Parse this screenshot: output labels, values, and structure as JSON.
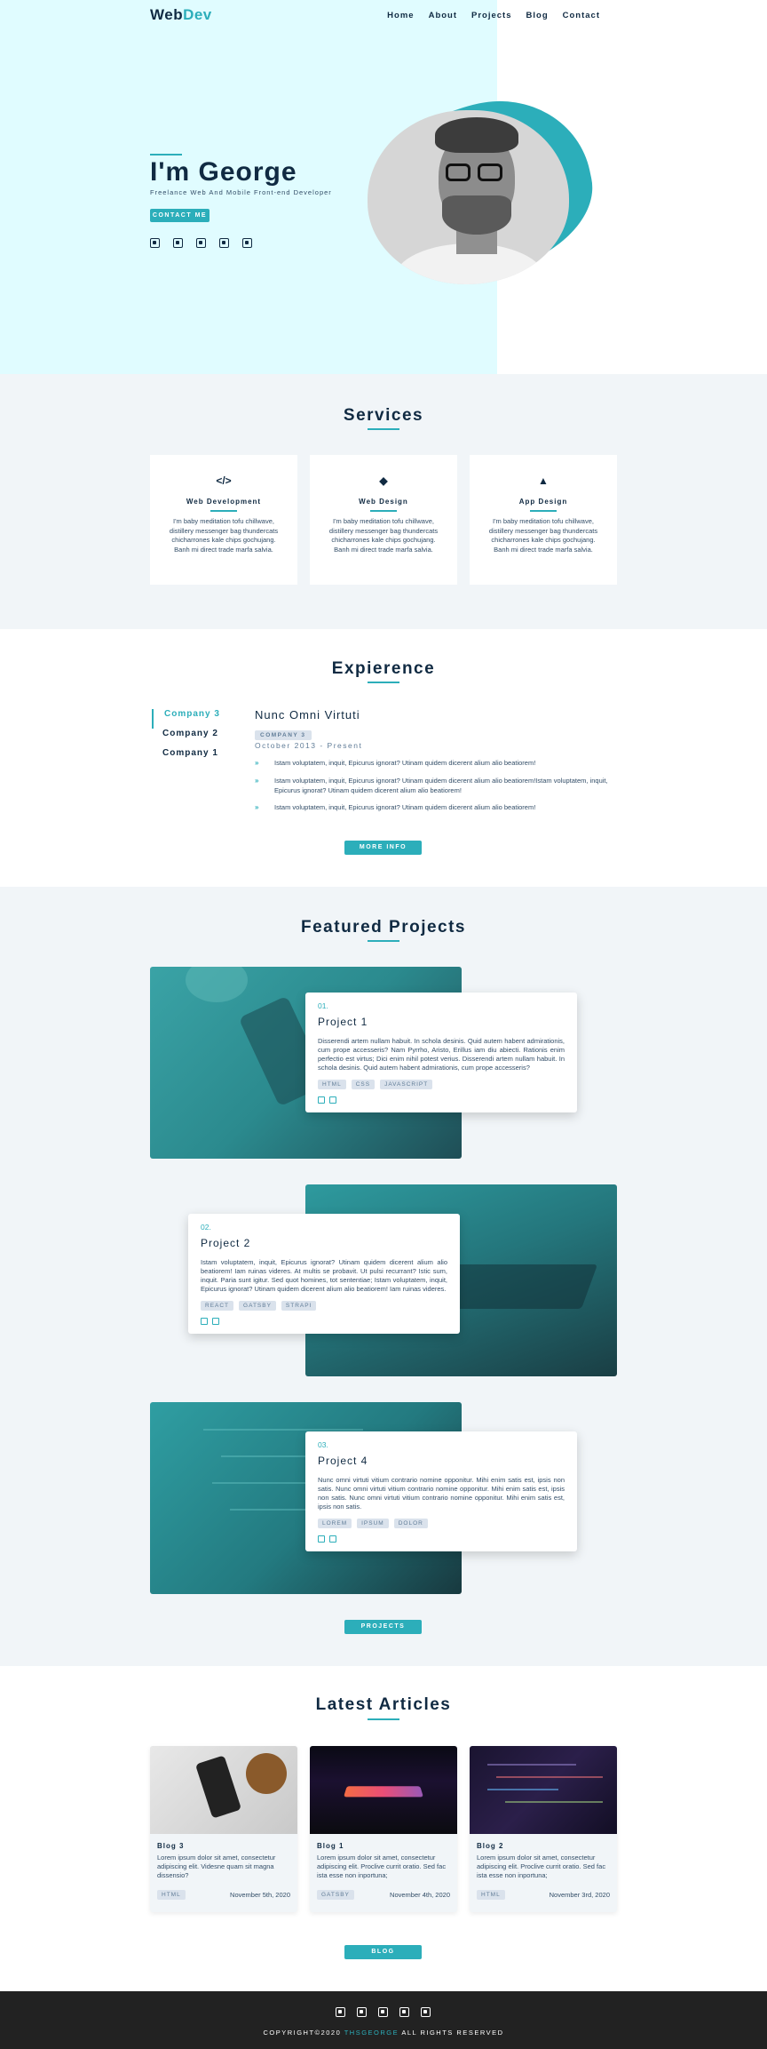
{
  "nav": {
    "logo_a": "Web",
    "logo_b": "Dev",
    "links": [
      "Home",
      "About",
      "Projects",
      "Blog",
      "Contact"
    ]
  },
  "hero": {
    "title": "I'm George",
    "subtitle": "Freelance Web And Mobile Front-end Developer",
    "cta": "CONTACT ME",
    "social": [
      "facebook-icon",
      "linkedin-icon",
      "squarespace-icon",
      "sourcetree-icon",
      "twitter-icon"
    ]
  },
  "services": {
    "title": "Services",
    "items": [
      {
        "icon": "</>",
        "title": "Web Development",
        "text": "I'm baby meditation tofu chillwave, distillery messenger bag thundercats chicharrones kale chips gochujang. Banh mi direct trade marfa salvia."
      },
      {
        "icon": "◆",
        "title": "Web Design",
        "text": "I'm baby meditation tofu chillwave, distillery messenger bag thundercats chicharrones kale chips gochujang. Banh mi direct trade marfa salvia."
      },
      {
        "icon": "▲",
        "title": "App Design",
        "text": "I'm baby meditation tofu chillwave, distillery messenger bag thundercats chicharrones kale chips gochujang. Banh mi direct trade marfa salvia."
      }
    ]
  },
  "experience": {
    "title": "Expierence",
    "tabs": [
      "Company 3",
      "Company 2",
      "Company 1"
    ],
    "job_title": "Nunc Omni Virtuti",
    "company": "COMPANY 3",
    "date": "October 2013 - Present",
    "duties": [
      "Istam voluptatem, inquit, Epicurus ignorat? Utinam quidem dicerent alium alio beatiorem!",
      "Istam voluptatem, inquit, Epicurus ignorat? Utinam quidem dicerent alium alio beatiorem!Istam voluptatem, inquit, Epicurus ignorat? Utinam quidem dicerent alium alio beatiorem!",
      "Istam voluptatem, inquit, Epicurus ignorat? Utinam quidem dicerent alium alio beatiorem!"
    ],
    "more": "MORE INFO"
  },
  "projects": {
    "title": "Featured Projects",
    "items": [
      {
        "num": "01.",
        "name": "Project 1",
        "desc": "Disserendi artem nullam habuit. In schola desinis. Quid autem habent admirationis, cum prope accesseris? Nam Pyrrho, Aristo, Erillus iam diu abiecti. Rationis enim perfectio est virtus; Dici enim nihil potest verius. Disserendi artem nullam habuit. In schola desinis. Quid autem habent admirationis, cum prope accesseris?",
        "tags": [
          "HTML",
          "CSS",
          "JAVASCRIPT"
        ]
      },
      {
        "num": "02.",
        "name": "Project 2",
        "desc": "Istam voluptatem, inquit, Epicurus ignorat? Utinam quidem dicerent alium alio beatiorem! Iam ruinas videres. At multis se probavit. Ut pulsi recurrant? Istic sum, inquit. Paria sunt igitur. Sed quot homines, tot sententiae; Istam voluptatem, inquit, Epicurus ignorat? Utinam quidem dicerent alium alio beatiorem! Iam ruinas videres.",
        "tags": [
          "REACT",
          "GATSBY",
          "STRAPI"
        ]
      },
      {
        "num": "03.",
        "name": "Project 4",
        "desc": "Nunc omni virtuti vitium contrario nomine opponitur. Mihi enim satis est, ipsis non satis. Nunc omni virtuti vitium contrario nomine opponitur. Mihi enim satis est, ipsis non satis. Nunc omni virtuti vitium contrario nomine opponitur. Mihi enim satis est, ipsis non satis.",
        "tags": [
          "LOREM",
          "IPSUM",
          "DOLOR"
        ]
      }
    ],
    "button": "PROJECTS"
  },
  "articles": {
    "title": "Latest Articles",
    "items": [
      {
        "title": "Blog 3",
        "text": "Lorem ipsum dolor sit amet, consectetur adipiscing elit. Videsne quam sit magna dissensio?",
        "tag": "HTML",
        "date": "November 5th, 2020"
      },
      {
        "title": "Blog 1",
        "text": "Lorem ipsum dolor sit amet, consectetur adipiscing elit. Proclive currit oratio. Sed fac ista esse non inportuna;",
        "tag": "GATSBY",
        "date": "November 4th, 2020"
      },
      {
        "title": "Blog 2",
        "text": "Lorem ipsum dolor sit amet, consectetur adipiscing elit. Proclive currit oratio. Sed fac ista esse non inportuna;",
        "tag": "HTML",
        "date": "November 3rd, 2020"
      }
    ],
    "button": "BLOG"
  },
  "footer": {
    "copy_a": "COPYRIGHT©2020 ",
    "copy_b": "THSGEORGE",
    "copy_c": " ALL RIGHTS RESERVED"
  },
  "colors": {
    "accent": "#2caeba",
    "hero_bg": "#e0fcff",
    "dark": "#102a42",
    "section_grey": "#f1f5f8",
    "footer": "#222222"
  }
}
